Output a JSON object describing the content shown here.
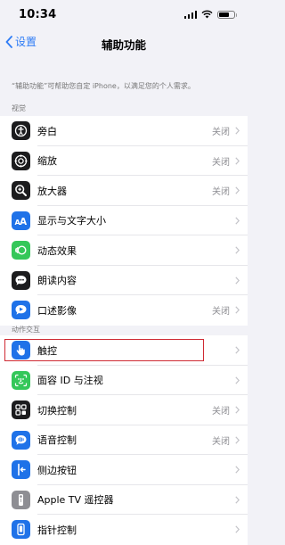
{
  "status_bar": {
    "time": "10:34"
  },
  "nav": {
    "back_label": "设置",
    "title": "辅助功能"
  },
  "description": "“辅助功能”可帮助您自定 iPhone，以满足您的个人需求。",
  "sections": [
    {
      "header": "视觉",
      "items": [
        {
          "name": "voiceover",
          "label": "旁白",
          "value": "关闭",
          "icon": "voiceover-icon",
          "color": "#1c1c1e"
        },
        {
          "name": "zoom",
          "label": "缩放",
          "value": "关闭",
          "icon": "zoom-icon",
          "color": "#1c1c1e"
        },
        {
          "name": "magnifier",
          "label": "放大器",
          "value": "关闭",
          "icon": "magnifier-icon",
          "color": "#1c1c1e"
        },
        {
          "name": "display-text",
          "label": "显示与文字大小",
          "value": "",
          "icon": "text-size-icon",
          "color": "#1f72e8"
        },
        {
          "name": "motion",
          "label": "动态效果",
          "value": "",
          "icon": "motion-icon",
          "color": "#34c759"
        },
        {
          "name": "spoken",
          "label": "朗读内容",
          "value": "",
          "icon": "spoken-icon",
          "color": "#1c1c1e"
        },
        {
          "name": "audio-desc",
          "label": "口述影像",
          "value": "关闭",
          "icon": "audio-desc-icon",
          "color": "#1f72e8"
        }
      ]
    },
    {
      "header": "动作交互",
      "items": [
        {
          "name": "touch",
          "label": "触控",
          "value": "",
          "icon": "touch-icon",
          "color": "#1f72e8"
        },
        {
          "name": "face-id",
          "label": "面容 ID 与注视",
          "value": "",
          "icon": "face-id-icon",
          "color": "#34c759"
        },
        {
          "name": "switch-control",
          "label": "切换控制",
          "value": "关闭",
          "icon": "switch-control-icon",
          "color": "#1c1c1e"
        },
        {
          "name": "voice-control",
          "label": "语音控制",
          "value": "关闭",
          "icon": "voice-control-icon",
          "color": "#1f72e8"
        },
        {
          "name": "side-button",
          "label": "侧边按钮",
          "value": "",
          "icon": "side-button-icon",
          "color": "#1f72e8"
        },
        {
          "name": "apple-tv",
          "label": "Apple TV 遥控器",
          "value": "",
          "icon": "remote-icon",
          "color": "#8e8e93"
        },
        {
          "name": "pointer",
          "label": "指针控制",
          "value": "",
          "icon": "pointer-icon",
          "color": "#1f72e8"
        }
      ]
    }
  ]
}
